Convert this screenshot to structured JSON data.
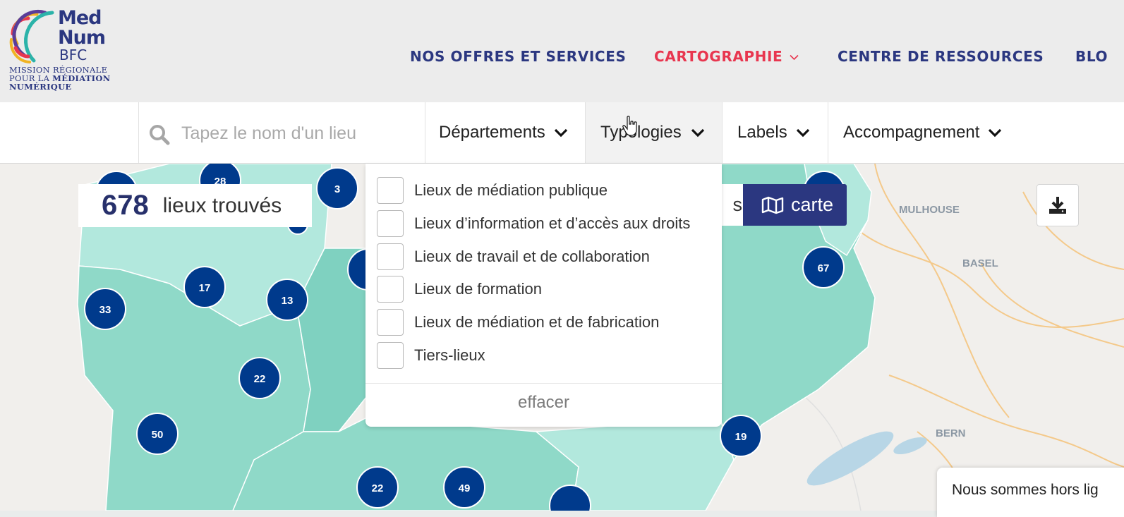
{
  "brand": {
    "line1": "Med",
    "line2": "Num",
    "line3": "BFC",
    "tagline1": "MISSION RÉGIONALE",
    "tagline2_prefix": "POUR LA ",
    "tagline2_bold": "MÉDIATION",
    "tagline3": "NUMÉRIQUE"
  },
  "nav": {
    "items": [
      {
        "label": "NOS OFFRES ET SERVICES"
      },
      {
        "label": "CARTOGRAPHIE"
      },
      {
        "label": "CENTRE DE RESSOURCES"
      },
      {
        "label": "BLO"
      }
    ],
    "active_color": "#e8364f",
    "color": "#2b3780"
  },
  "search": {
    "placeholder": "Tapez le nom d'un lieu",
    "value": ""
  },
  "filters": [
    {
      "label": "Départements"
    },
    {
      "label": "Typologies"
    },
    {
      "label": "Labels"
    },
    {
      "label": "Accompagnement"
    }
  ],
  "results": {
    "count": "678",
    "label": "lieux trouvés"
  },
  "view_toggle": {
    "list_label_fragment": "s",
    "map_label": "carte"
  },
  "typologies_menu": {
    "options": [
      {
        "label": "Lieux de médiation publique",
        "checked": false
      },
      {
        "label": "Lieux d’information et d’accès aux droits",
        "checked": false
      },
      {
        "label": "Lieux de travail et de collaboration",
        "checked": false
      },
      {
        "label": "Lieux de formation",
        "checked": false
      },
      {
        "label": "Lieux de médiation et de fabrication",
        "checked": false
      },
      {
        "label": "Tiers-lieux",
        "checked": false
      }
    ],
    "clear_label": "effacer"
  },
  "map": {
    "city_labels": [
      "MULHOUSE",
      "BASEL",
      "BERN"
    ],
    "cluster_color": "#003a8c",
    "clusters": [
      {
        "count": "28"
      },
      {
        "count": "3"
      },
      {
        "count": "17"
      },
      {
        "count": "33"
      },
      {
        "count": "13"
      },
      {
        "count": "22"
      },
      {
        "count": "50"
      },
      {
        "count": "22"
      },
      {
        "count": "49"
      },
      {
        "count": "67"
      },
      {
        "count": "19"
      }
    ]
  },
  "chat": {
    "text": "Nous sommes hors lig"
  }
}
